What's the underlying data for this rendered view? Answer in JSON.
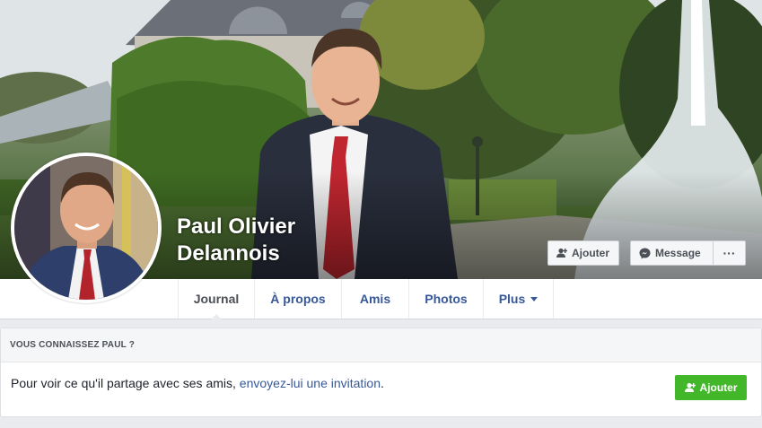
{
  "profile": {
    "name_line1": "Paul Olivier",
    "name_line2": "Delannois"
  },
  "cover_buttons": {
    "add_friend": "Ajouter",
    "message": "Message",
    "more": "···"
  },
  "tabs": [
    {
      "label": "Journal",
      "active": true
    },
    {
      "label": "À propos"
    },
    {
      "label": "Amis"
    },
    {
      "label": "Photos"
    },
    {
      "label": "Plus"
    }
  ],
  "know_card": {
    "title": "VOUS CONNAISSEZ PAUL ?",
    "text_before": "Pour voir ce qu'il partage avec ses amis, ",
    "link": "envoyez-lui une invitation",
    "text_after": ".",
    "button": "Ajouter"
  },
  "colors": {
    "link_blue": "#365899",
    "green": "#42b72a",
    "page_bg": "#e9ebee"
  },
  "icons": [
    "add-friend-icon",
    "messenger-icon",
    "more-icon",
    "caret-down-icon"
  ]
}
